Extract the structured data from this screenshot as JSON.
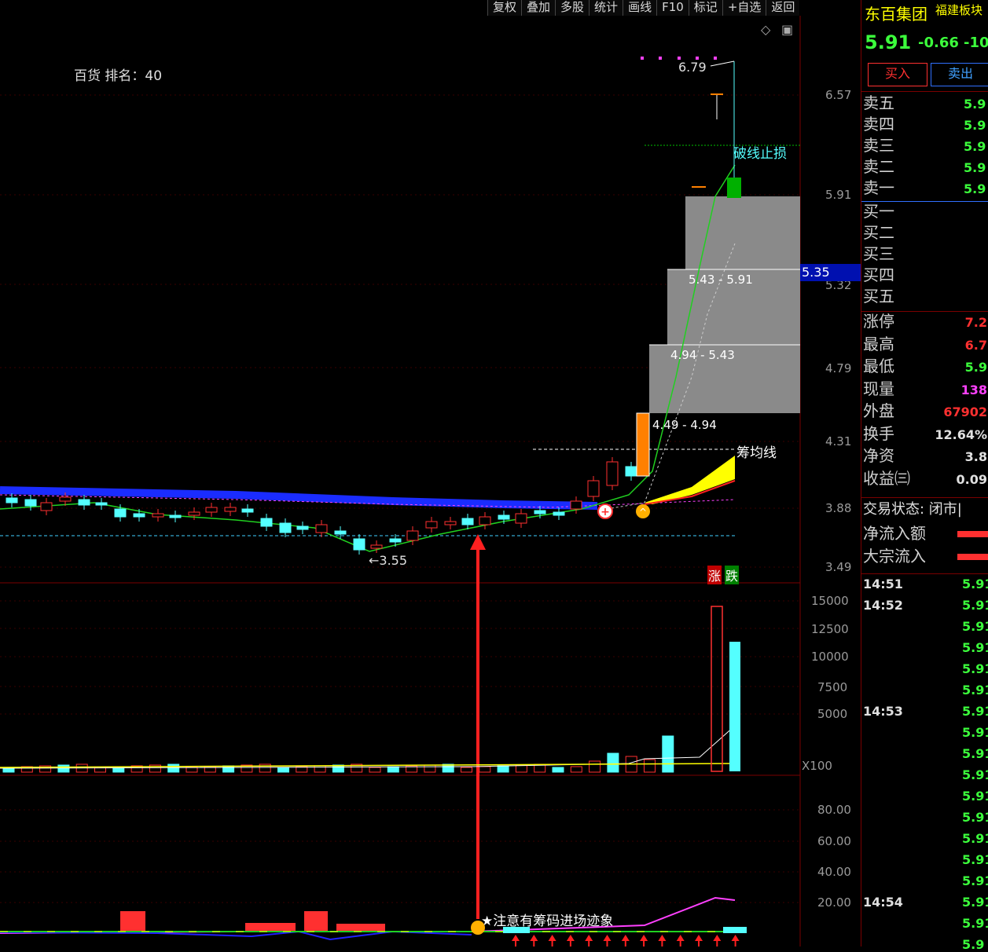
{
  "toolbar": [
    "复权",
    "叠加",
    "多股",
    "统计",
    "画线",
    "F10",
    "标记",
    "+自选",
    "返回"
  ],
  "ranking_label": "百货 排名：40",
  "price_axis": [
    "6.57",
    "5.91",
    "5.32",
    "4.79",
    "4.31",
    "3.88",
    "3.49"
  ],
  "current_price_tag": "5.35",
  "annotations": {
    "high_label": "6.79",
    "low_label": "←3.55",
    "stop_loss": "破线止损",
    "avg_cost_line": "筹均线",
    "rise_label": "涨",
    "fall_label": "跌",
    "chip_notice": "注意有筹码进场迹象"
  },
  "chip_zones": [
    "5.43 - 5.91",
    "4.94 - 5.43",
    "4.49 - 4.94"
  ],
  "volume_axis": [
    "15000",
    "12500",
    "10000",
    "7500",
    "5000"
  ],
  "volume_unit": "X100",
  "indicator_axis": [
    "80.00",
    "60.00",
    "40.00",
    "20.00"
  ],
  "stock": {
    "name": "东百集团",
    "sector": "福建板块",
    "price": "5.91",
    "change": "-0.66",
    "change_pct": "-10",
    "buy_label": "买入",
    "sell_label": "卖出"
  },
  "order_book": {
    "asks": [
      {
        "label": "卖五",
        "price": "5.9"
      },
      {
        "label": "卖四",
        "price": "5.9"
      },
      {
        "label": "卖三",
        "price": "5.9"
      },
      {
        "label": "卖二",
        "price": "5.9"
      },
      {
        "label": "卖一",
        "price": "5.9"
      }
    ],
    "bids": [
      {
        "label": "买一"
      },
      {
        "label": "买二"
      },
      {
        "label": "买三"
      },
      {
        "label": "买四"
      },
      {
        "label": "买五"
      }
    ]
  },
  "stats": [
    {
      "label": "涨停",
      "value": "7.2",
      "color": "#ff3030"
    },
    {
      "label": "最高",
      "value": "6.7",
      "color": "#ff3030"
    },
    {
      "label": "最低",
      "value": "5.9",
      "color": "#3cff3c"
    },
    {
      "label": "现量",
      "value": "138",
      "color": "#ff40ff"
    },
    {
      "label": "外盘",
      "value": "67902",
      "color": "#ff3030"
    },
    {
      "label": "换手",
      "value": "12.64%",
      "color": "#e0e0e0"
    },
    {
      "label": "净资",
      "value": "3.8",
      "color": "#e0e0e0"
    },
    {
      "label": "收益㈢",
      "value": "0.09",
      "color": "#e0e0e0"
    }
  ],
  "trade_status": "交易状态: 闭市|",
  "flows": [
    {
      "label": "净流入额",
      "color": "#ff3030"
    },
    {
      "label": "大宗流入",
      "color": "#ff3030"
    }
  ],
  "ticks": [
    {
      "time": "14:51",
      "price": "5.91"
    },
    {
      "time": "14:52",
      "price": "5.91"
    },
    {
      "time": "",
      "price": "5.91"
    },
    {
      "time": "",
      "price": "5.91"
    },
    {
      "time": "",
      "price": "5.91"
    },
    {
      "time": "",
      "price": "5.91"
    },
    {
      "time": "14:53",
      "price": "5.91"
    },
    {
      "time": "",
      "price": "5.91"
    },
    {
      "time": "",
      "price": "5.91"
    },
    {
      "time": "",
      "price": "5.91"
    },
    {
      "time": "",
      "price": "5.91"
    },
    {
      "time": "",
      "price": "5.91"
    },
    {
      "time": "",
      "price": "5.91"
    },
    {
      "time": "",
      "price": "5.91"
    },
    {
      "time": "",
      "price": "5.91"
    },
    {
      "time": "14:54",
      "price": "5.91"
    },
    {
      "time": "",
      "price": "5.91"
    },
    {
      "time": "",
      "price": "5.9"
    }
  ],
  "colors": {
    "up": "#ff3030",
    "down": "#54ffff",
    "ma": "#00d000",
    "panel_line": "#7a0000",
    "accent": "#ffff00"
  }
}
